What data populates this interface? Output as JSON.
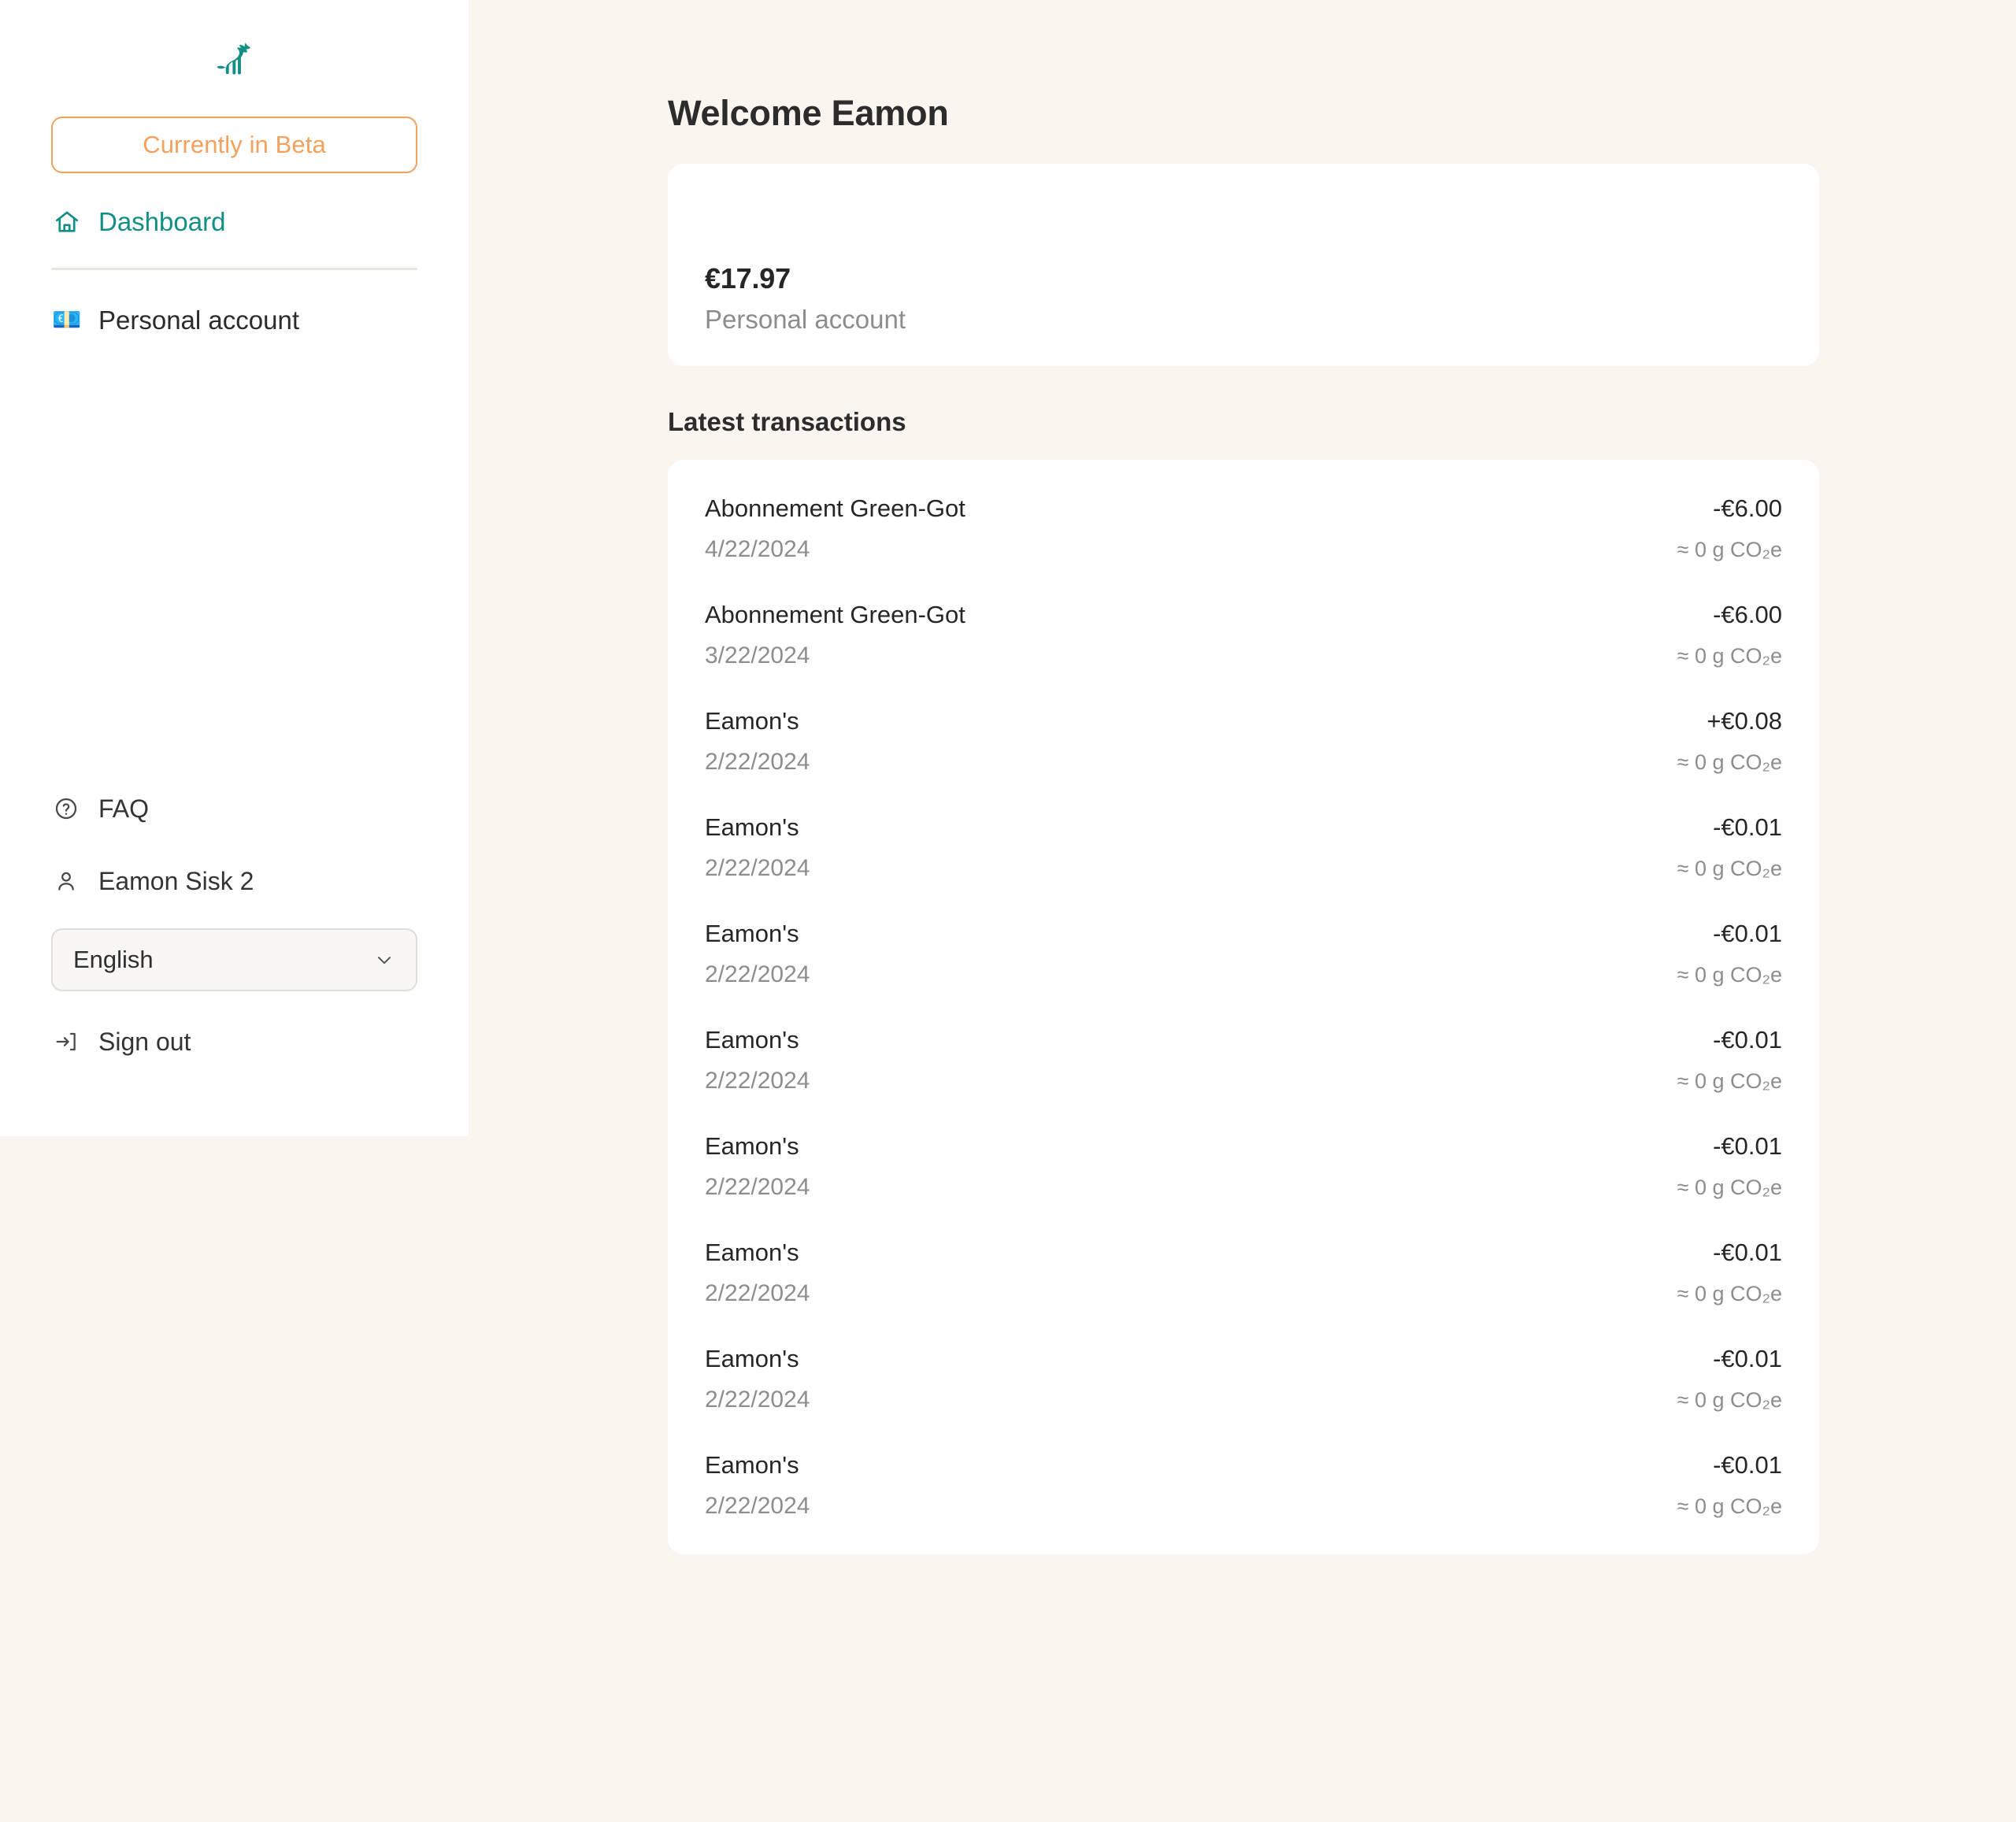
{
  "brand": {
    "logo_icon": "fox-logo-icon",
    "accent_teal": "#128f84",
    "accent_orange": "#f3a15c",
    "background": "#faf5ef",
    "card_background": "#ffffff"
  },
  "sidebar": {
    "beta_badge": "Currently in Beta",
    "nav": [
      {
        "label": "Dashboard",
        "icon": "home-icon",
        "active": true
      },
      {
        "label": "Personal account",
        "icon": "euro-banknote-icon",
        "emoji": "💶",
        "active": false
      }
    ],
    "bottom": {
      "faq": {
        "label": "FAQ",
        "icon": "help-circle-icon"
      },
      "user": {
        "label": "Eamon Sisk 2",
        "icon": "user-icon"
      },
      "language": {
        "value": "English",
        "icon": "chevron-down-icon"
      },
      "signout": {
        "label": "Sign out",
        "icon": "logout-icon"
      }
    }
  },
  "main": {
    "page_title": "Welcome Eamon",
    "balance": {
      "amount": "€17.97",
      "label": "Personal account"
    },
    "transactions_heading": "Latest transactions",
    "transactions": [
      {
        "name": "Abonnement Green-Got",
        "date": "4/22/2024",
        "amount": "-€6.00",
        "co2": "≈ 0 g CO₂e"
      },
      {
        "name": "Abonnement Green-Got",
        "date": "3/22/2024",
        "amount": "-€6.00",
        "co2": "≈ 0 g CO₂e"
      },
      {
        "name": "Eamon's",
        "date": "2/22/2024",
        "amount": "+€0.08",
        "co2": "≈ 0 g CO₂e"
      },
      {
        "name": "Eamon's",
        "date": "2/22/2024",
        "amount": "-€0.01",
        "co2": "≈ 0 g CO₂e"
      },
      {
        "name": "Eamon's",
        "date": "2/22/2024",
        "amount": "-€0.01",
        "co2": "≈ 0 g CO₂e"
      },
      {
        "name": "Eamon's",
        "date": "2/22/2024",
        "amount": "-€0.01",
        "co2": "≈ 0 g CO₂e"
      },
      {
        "name": "Eamon's",
        "date": "2/22/2024",
        "amount": "-€0.01",
        "co2": "≈ 0 g CO₂e"
      },
      {
        "name": "Eamon's",
        "date": "2/22/2024",
        "amount": "-€0.01",
        "co2": "≈ 0 g CO₂e"
      },
      {
        "name": "Eamon's",
        "date": "2/22/2024",
        "amount": "-€0.01",
        "co2": "≈ 0 g CO₂e"
      },
      {
        "name": "Eamon's",
        "date": "2/22/2024",
        "amount": "-€0.01",
        "co2": "≈ 0 g CO₂e"
      }
    ]
  }
}
